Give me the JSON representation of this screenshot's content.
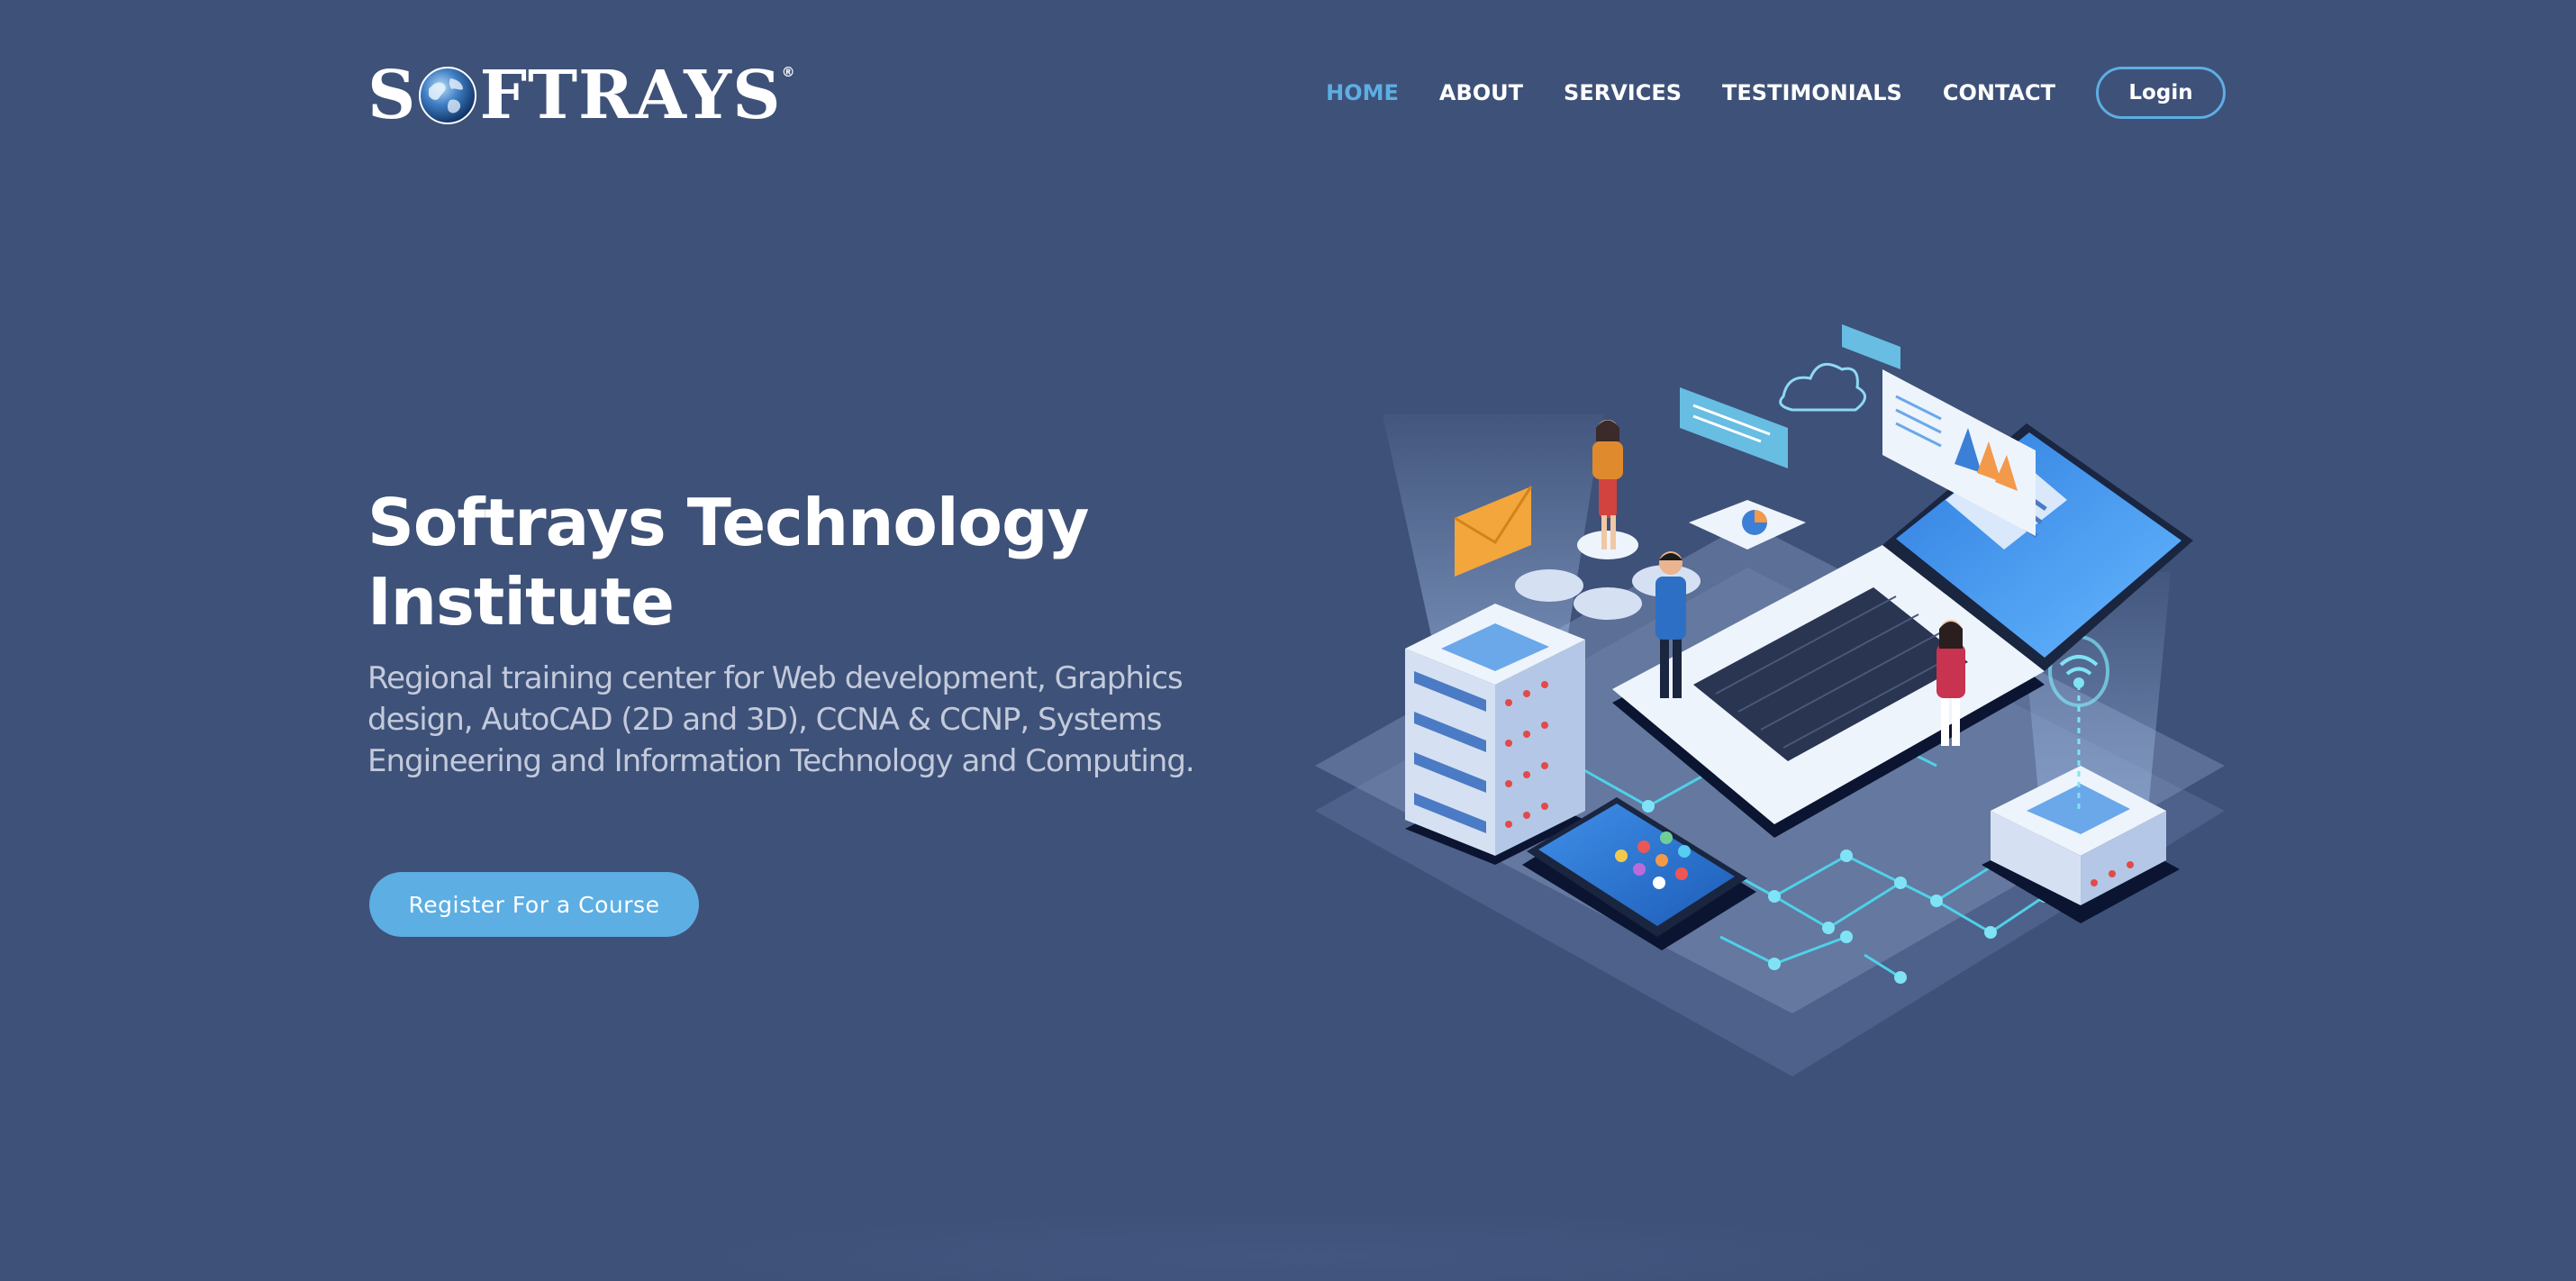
{
  "brand": {
    "logo_left": "S",
    "logo_right": "FTRAYS",
    "logo_mark": "®"
  },
  "nav": {
    "items": [
      {
        "label": "HOME",
        "active": true
      },
      {
        "label": "ABOUT"
      },
      {
        "label": "SERVICES"
      },
      {
        "label": "TESTIMONIALS"
      },
      {
        "label": "CONTACT"
      }
    ],
    "login_label": "Login"
  },
  "hero": {
    "title": "Softrays Technology Institute",
    "subtitle": "Regional training center for Web development, Graphics design, AutoCAD (2D and 3D), CCNA & CCNP, Systems Engineering and Information Technology and Computing.",
    "cta_label": "Register For a Course"
  },
  "illustration": {
    "subject": "isometric laptop, servers, phone and people",
    "icons": [
      "globe-icon",
      "laptop-icon",
      "server-icon",
      "smartphone-icon",
      "envelope-icon",
      "cloud-icon",
      "wifi-icon",
      "chart-icon"
    ]
  },
  "colors": {
    "background": "#3e5178",
    "accent": "#5daee3",
    "text": "#ffffff",
    "muted_text": "#c3cadb"
  }
}
